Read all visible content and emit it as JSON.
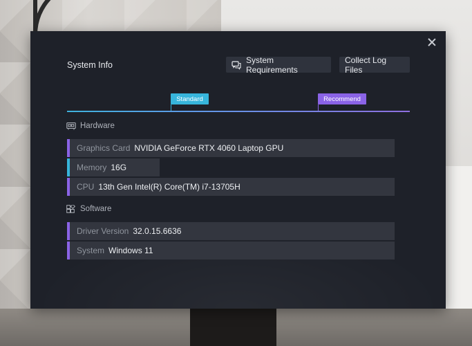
{
  "dialog": {
    "title": "System Info",
    "buttons": {
      "system_requirements": "System Requirements",
      "collect_log_files": "Collect Log Files"
    },
    "tags": {
      "standard": "Standard",
      "recommend": "Recommend"
    },
    "sections": {
      "hardware": {
        "title": "Hardware",
        "rows": [
          {
            "label": "Graphics Card",
            "value": "NVIDIA GeForce RTX 4060 Laptop GPU"
          },
          {
            "label": "Memory",
            "value": "16G"
          },
          {
            "label": "CPU",
            "value": "13th Gen Intel(R) Core(TM) i7-13705H"
          }
        ]
      },
      "software": {
        "title": "Software",
        "rows": [
          {
            "label": "Driver Version",
            "value": "32.0.15.6636"
          },
          {
            "label": "System",
            "value": "Windows 11"
          }
        ]
      }
    },
    "icons": {
      "close": "close-icon",
      "system_requirements": "chat-icon",
      "hardware": "hardware-icon",
      "software": "software-icon"
    },
    "colors": {
      "standard": "#37b5db",
      "recommend": "#8a63e6",
      "dialog_bg": "#1e2129",
      "row_bg": "#33363f"
    }
  }
}
